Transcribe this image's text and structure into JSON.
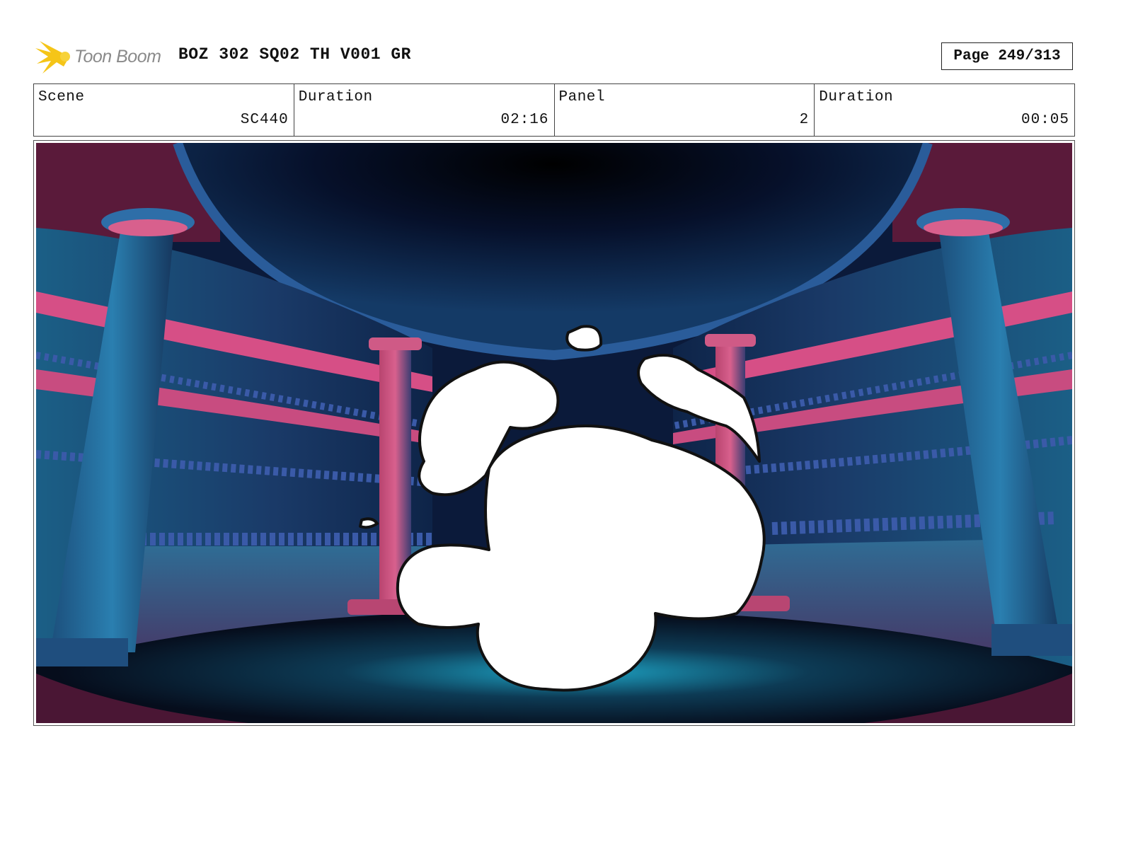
{
  "header": {
    "logo_text": "Toon Boom",
    "title": "BOZ 302 SQ02 TH V001 GR",
    "page": "Page 249/313"
  },
  "info": {
    "scene_label": "Scene",
    "scene_value": "SC440",
    "duration_label": "Duration",
    "duration_value": "02:16",
    "panel_label": "Panel",
    "panel_value": "2",
    "panel_duration_label": "Duration",
    "panel_duration_value": "00:05"
  },
  "panel": {
    "image_icon": "storyboard-panel-image"
  },
  "colors": {
    "logo_yellow": "#f5c518",
    "room_blue": "#1b5f86",
    "room_pink": "#d64f86",
    "dark_ceiling": "#06102a"
  }
}
